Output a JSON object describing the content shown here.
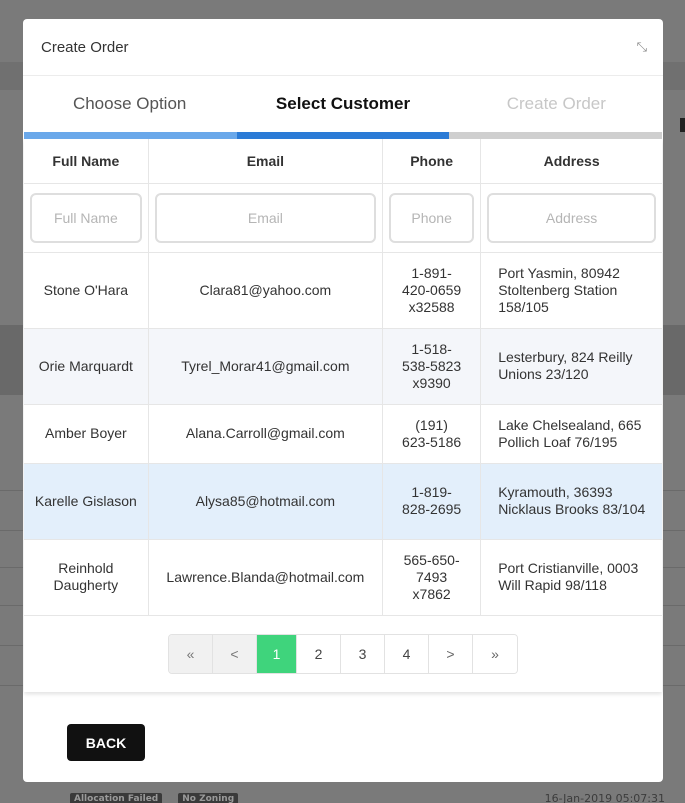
{
  "modal": {
    "title": "Create Order",
    "back_label": "BACK"
  },
  "steps": [
    {
      "label": "Choose Option",
      "state": "done"
    },
    {
      "label": "Select Customer",
      "state": "active"
    },
    {
      "label": "Create Order",
      "state": "todo"
    }
  ],
  "colors": {
    "step_done": "#6aa8ea",
    "step_active": "#2b7bd6",
    "step_todo": "#cfcfcf",
    "page_current": "#3fd47c"
  },
  "table": {
    "headers": [
      "Full Name",
      "Email",
      "Phone",
      "Address"
    ],
    "filters": {
      "name_placeholder": "Full Name",
      "email_placeholder": "Email",
      "phone_placeholder": "Phone",
      "address_placeholder": "Address"
    },
    "rows": [
      {
        "name": "Stone O'Hara",
        "email": "Clara81@yahoo.com",
        "phone": "1-891-420-0659 x32588",
        "address": "Port Yasmin, 80942 Stoltenberg Station 158/105"
      },
      {
        "name": "Orie Marquardt",
        "email": "Tyrel_Morar41@gmail.com",
        "phone": "1-518-538-5823 x9390",
        "address": "Lesterbury, 824 Reilly Unions 23/120"
      },
      {
        "name": "Amber Boyer",
        "email": "Alana.Carroll@gmail.com",
        "phone": "(191) 623-5186",
        "address": "Lake Chelsealand, 665 Pollich Loaf 76/195"
      },
      {
        "name": "Karelle Gislason",
        "email": "Alysa85@hotmail.com",
        "phone": "1-819-828-2695",
        "address": "Kyramouth, 36393 Nicklaus Brooks 83/104"
      },
      {
        "name": "Reinhold Daugherty",
        "email": "Lawrence.Blanda@hotmail.com",
        "phone": "565-650-7493 x7862",
        "address": "Port Cristianville, 0003 Will Rapid 98/118"
      }
    ]
  },
  "pagination": {
    "first": "«",
    "prev": "<",
    "next": ">",
    "last": "»",
    "pages": [
      "1",
      "2",
      "3",
      "4"
    ],
    "current": "1"
  },
  "background": {
    "tag1": "Allocation Failed",
    "tag2": "No Zoning",
    "timestamp": "16-Jan-2019 05:07:31"
  }
}
